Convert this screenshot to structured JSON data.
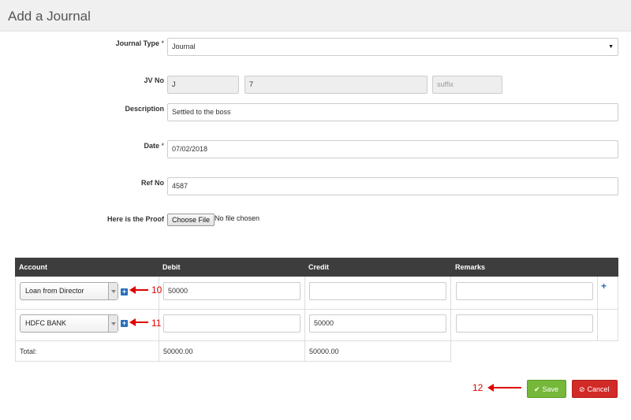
{
  "page": {
    "title": "Add a Journal"
  },
  "form": {
    "journal_type": {
      "label": "Journal Type",
      "required_mark": "*",
      "value": "Journal"
    },
    "jv_no": {
      "label": "JV No",
      "prefix": "J",
      "number": "7",
      "suffix_placeholder": "suffix"
    },
    "description": {
      "label": "Description",
      "value": "Settled to the boss"
    },
    "date": {
      "label": "Date",
      "required_mark": "*",
      "value": "07/02/2018"
    },
    "ref_no": {
      "label": "Ref No",
      "value": "4587"
    },
    "proof": {
      "label": "Here is the Proof",
      "button": "Choose File",
      "status": "No file chosen"
    }
  },
  "table": {
    "headers": [
      "Account",
      "Debit",
      "Credit",
      "Remarks"
    ],
    "rows": [
      {
        "account": "Loan from Director",
        "debit": "50000",
        "credit": "",
        "remarks": ""
      },
      {
        "account": "HDFC BANK",
        "debit": "",
        "credit": "50000",
        "remarks": ""
      }
    ],
    "total": {
      "label": "Total:",
      "debit": "50000.00",
      "credit": "50000.00"
    },
    "add_row_icon": "plus-icon",
    "add_account_icon": "plus-square-icon"
  },
  "annotations": [
    "10",
    "11",
    "12"
  ],
  "actions": {
    "save": {
      "label": "Save",
      "icon": "check-icon",
      "color": "#75b83a"
    },
    "cancel": {
      "label": "Cancel",
      "icon": "ban-icon",
      "color": "#d12a27"
    }
  },
  "colors": {
    "annotation": "#e00000",
    "table_header": "#3d3d3d",
    "link": "#2a6ebb"
  }
}
